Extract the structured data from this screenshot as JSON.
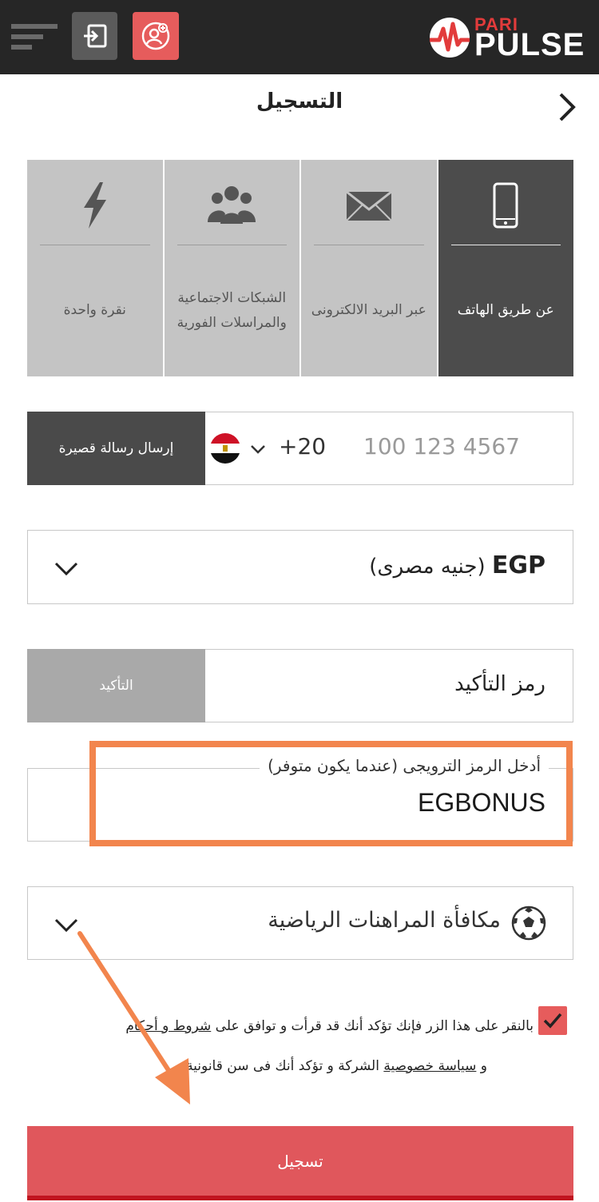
{
  "header": {
    "logo_top": "PARI",
    "logo_bottom": "PULSE",
    "brand_red": "#e23b3b",
    "accent_red": "#e65c5c",
    "bg": "#262626"
  },
  "page": {
    "title": "التسجيل"
  },
  "tabs": [
    {
      "label": "عن طريق الهاتف",
      "icon": "phone-icon",
      "active": true
    },
    {
      "label": "عبر البريد الالكترونى",
      "icon": "envelope-icon",
      "active": false
    },
    {
      "label": "الشبكات الاجتماعية والمراسلات الفورية",
      "icon": "users-icon",
      "active": false
    },
    {
      "label": "نقرة واحدة",
      "icon": "lightning-icon",
      "active": false
    }
  ],
  "phone": {
    "country_code": "+20",
    "placeholder": "100 123 4567",
    "sms_label": "إرسال رسالة قصيرة"
  },
  "currency": {
    "code": "EGP",
    "name": "(جنيه مصرى)"
  },
  "confirmation": {
    "placeholder": "رمز التأكيد",
    "button_label": "التأكيد"
  },
  "promo": {
    "label": "أدخل الرمز الترويجى (عندما يكون متوفر)",
    "value": "EGBONUS",
    "highlight_color": "#f2854d"
  },
  "bonus": {
    "value": "مكافأة المراهنات الرياضية"
  },
  "terms": {
    "checked": true,
    "line1_prefix": "بالنقر على هذا الزر فإنك تؤكد أنك قد قرأت و توافق على ",
    "link_terms": "شروط و أحكام",
    "line2_prefix": "و ",
    "link_privacy": "سياسة خصوصية",
    "line2_suffix": " الشركة و تؤكد أنك فى سن قانونية"
  },
  "submit": {
    "label": "تسجيل"
  }
}
